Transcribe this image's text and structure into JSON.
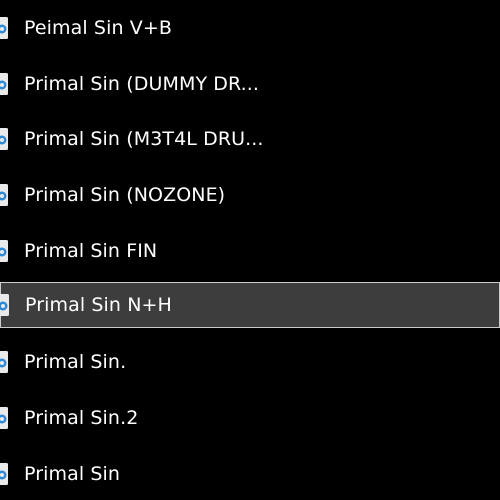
{
  "file_list": {
    "items": [
      {
        "label": "Peimal Sin V+B",
        "icon": "audio-file-icon",
        "selected": false
      },
      {
        "label": "Primal Sin (DUMMY DR...",
        "icon": "audio-file-icon",
        "selected": false
      },
      {
        "label": "Primal Sin (M3T4L DRU...",
        "icon": "audio-file-icon",
        "selected": false
      },
      {
        "label": "Primal Sin (NOZONE)",
        "icon": "audio-file-icon",
        "selected": false
      },
      {
        "label": "Primal Sin FIN",
        "icon": "audio-file-icon",
        "selected": false
      },
      {
        "label": "Primal Sin N+H",
        "icon": "audio-file-icon",
        "selected": true
      },
      {
        "label": "Primal Sin.",
        "icon": "audio-file-icon",
        "selected": false
      },
      {
        "label": "Primal Sin.2",
        "icon": "audio-file-icon",
        "selected": false
      },
      {
        "label": "Primal Sin",
        "icon": "audio-file-icon",
        "selected": false
      }
    ]
  },
  "colors": {
    "background": "#000000",
    "selected_background": "#3d3d3d",
    "selected_border": "#cccccc",
    "text": "#ffffff",
    "icon_accent": "#2e8ad8"
  }
}
